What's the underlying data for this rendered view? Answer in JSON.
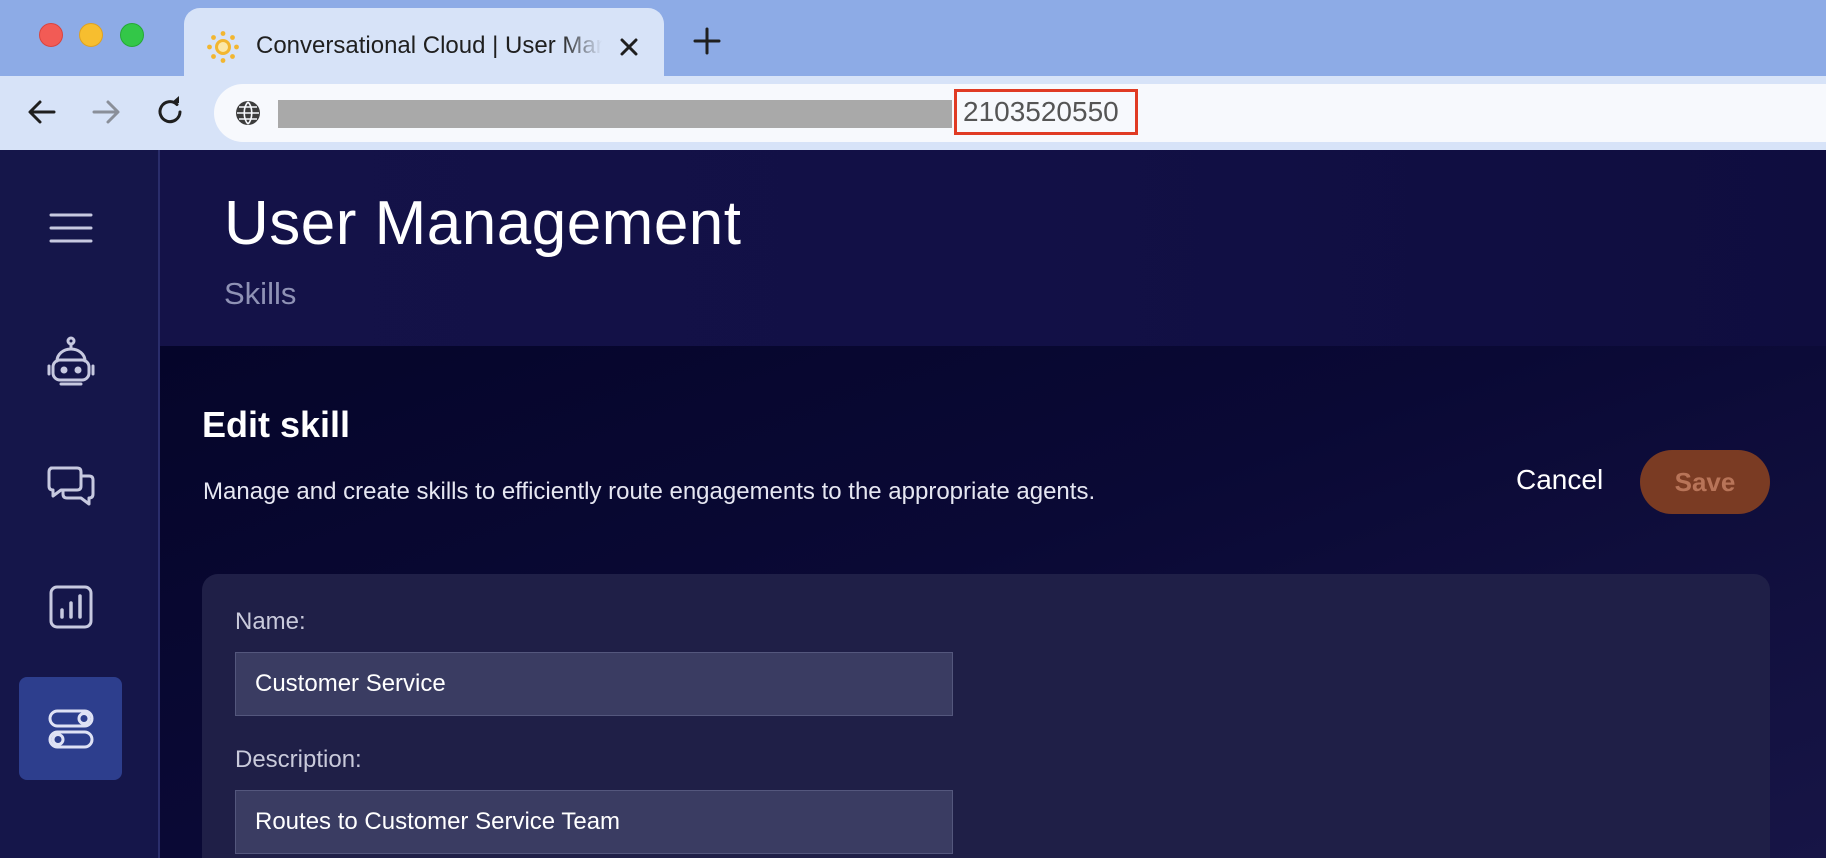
{
  "browser": {
    "tab_title": "Conversational Cloud | User Management",
    "new_tab_symbol": "+",
    "url_visible_part": "2103520550",
    "icons": [
      "favicon-sun-icon",
      "close-icon",
      "plus-icon",
      "back-arrow-icon",
      "forward-arrow-icon",
      "reload-icon",
      "globe-icon"
    ]
  },
  "sidebar": {
    "items": [
      {
        "name": "menu",
        "icon": "hamburger-menu-icon",
        "active": false
      },
      {
        "name": "bot",
        "icon": "robot-icon",
        "active": false
      },
      {
        "name": "conversations",
        "icon": "chat-bubbles-icon",
        "active": false
      },
      {
        "name": "reports",
        "icon": "bar-chart-icon",
        "active": false
      },
      {
        "name": "management",
        "icon": "toggles-icon",
        "active": true
      }
    ]
  },
  "header": {
    "title": "User Management",
    "subtitle": "Skills"
  },
  "edit_skill": {
    "title": "Edit skill",
    "description": "Manage and create skills to efficiently route engagements to the appropriate agents.",
    "cancel_label": "Cancel",
    "save_label": "Save"
  },
  "form": {
    "name_label": "Name:",
    "name_value": "Customer Service",
    "description_label": "Description:",
    "description_value": "Routes to Customer Service Team"
  },
  "colors": {
    "tabbar_bg": "#8dabe6",
    "toolbar_bg": "#d7e3f8",
    "app_bg": "#0b0a35",
    "sidebar_active": "#2d3e8d",
    "save_button_bg": "#7a3b23",
    "url_highlight": "#e03b24"
  }
}
